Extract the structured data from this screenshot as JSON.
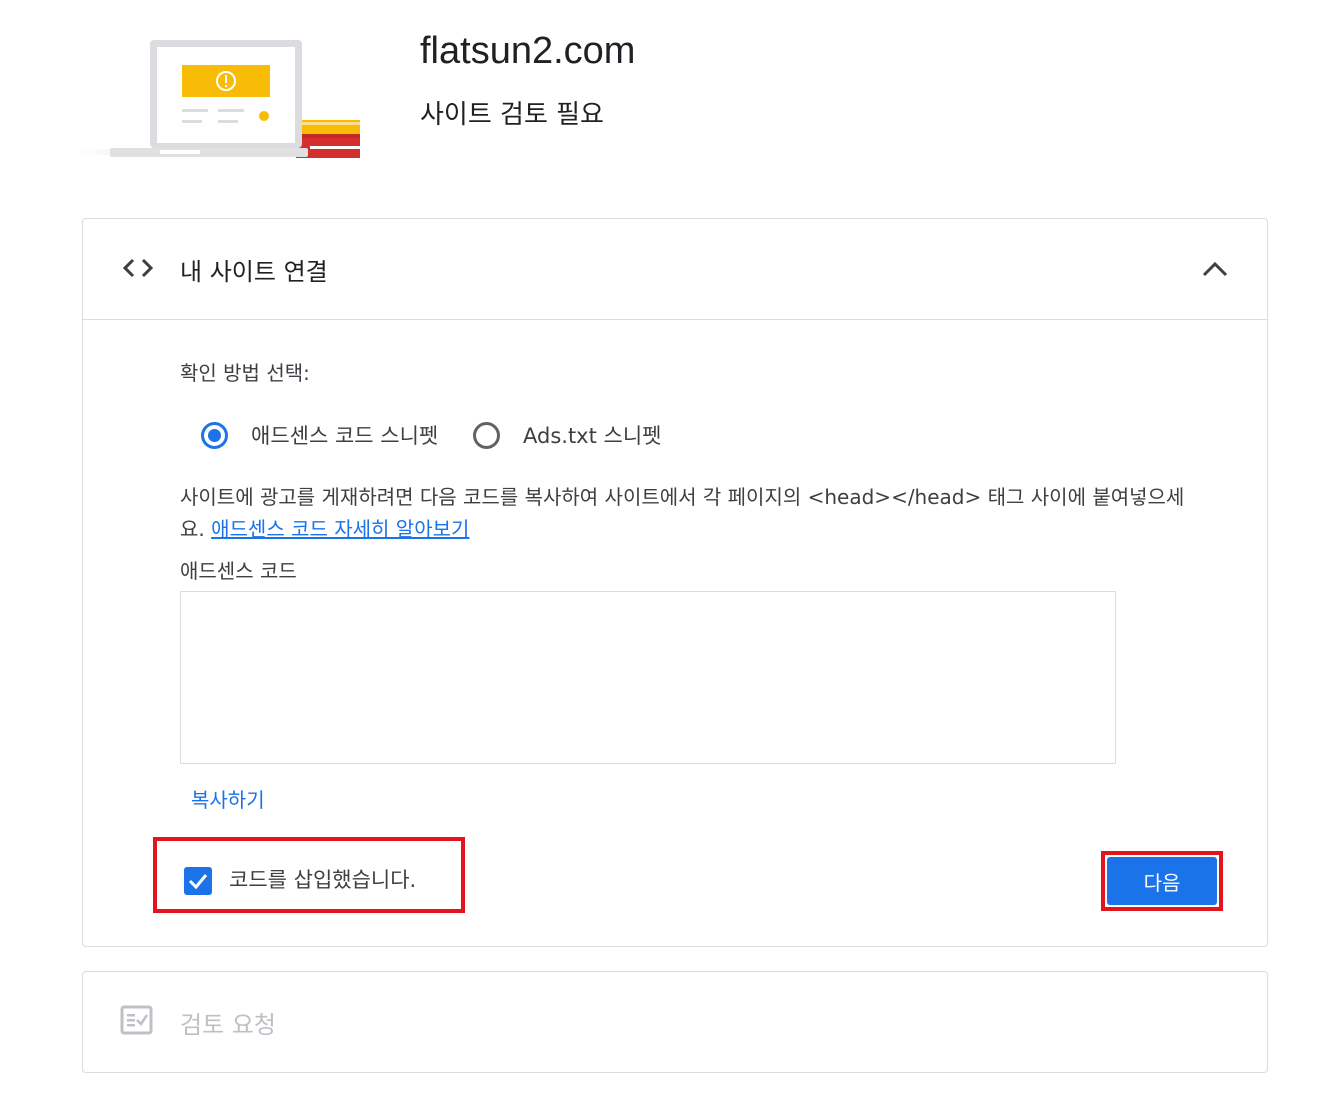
{
  "header": {
    "site_name": "flatsun2.com",
    "status": "사이트 검토 필요",
    "illustration_icon": "laptop-warning-illustration"
  },
  "connect_section": {
    "icon": "code-icon",
    "title": "내 사이트 연결",
    "collapse_icon": "chevron-up-icon",
    "method_label": "확인 방법 선택:",
    "methods": [
      {
        "label": "애드센스 코드 스니펫",
        "selected": true
      },
      {
        "label": "Ads.txt 스니펫",
        "selected": false
      }
    ],
    "description": "사이트에 광고를 게재하려면 다음 코드를 복사하여 사이트에서 각 페이지의 <head></head> 태그 사이에 붙여넣으세요.",
    "learn_more": "애드센스 코드 자세히 알아보기",
    "code_label": "애드센스 코드",
    "code_value": "",
    "copy_button": "복사하기",
    "confirm_checkbox": {
      "label": "코드를 삽입했습니다.",
      "checked": true
    },
    "next_button": "다음"
  },
  "review_section": {
    "icon": "review-checklist-icon",
    "title": "검토 요청"
  },
  "colors": {
    "accent": "#1a73e8",
    "highlight": "#e3151c",
    "illustration_yellow": "#f9bc06",
    "disabled": "#bdc1c6"
  }
}
